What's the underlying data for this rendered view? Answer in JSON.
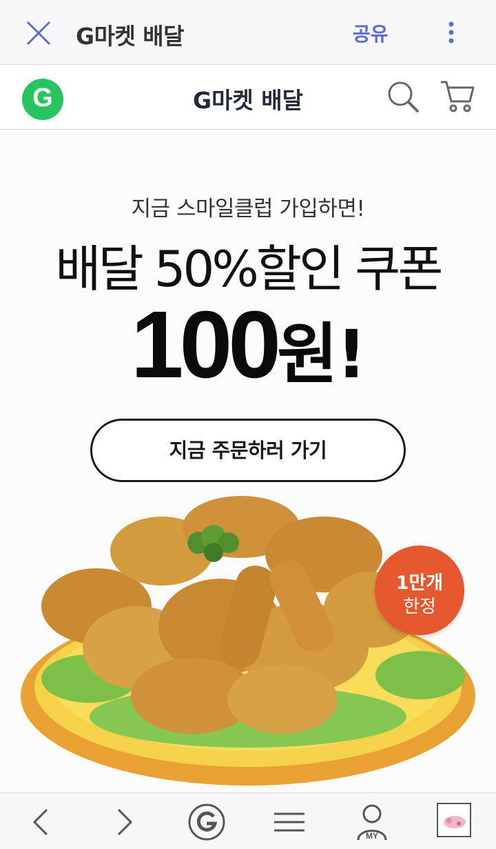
{
  "topbar": {
    "title": "G마켓 배달",
    "share_label": "공유",
    "close_icon": "close-icon",
    "more_icon": "more-vertical-icon",
    "accent": "#5b6bd1"
  },
  "header": {
    "logo_letter": "G",
    "logo_color": "#27c45f",
    "title": "G마켓 배달",
    "search_icon": "search-icon",
    "cart_icon": "cart-icon"
  },
  "banner": {
    "subtitle": "지금 스마일클럽 가입하면!",
    "headline": "배달 50%할인 쿠폰",
    "price_number": "100",
    "price_unit": "원!",
    "cta_label": "지금 주문하러 가기",
    "badge_line1": "1만개",
    "badge_line2": "한정",
    "badge_color": "#e5572c"
  },
  "bottombar": {
    "back_icon": "chevron-left-icon",
    "forward_icon": "chevron-right-icon",
    "home_icon": "g-home-icon",
    "menu_icon": "hamburger-menu-icon",
    "my_icon": "my-page-icon",
    "my_label": "MY",
    "tabs_icon": "tabs-icon"
  }
}
